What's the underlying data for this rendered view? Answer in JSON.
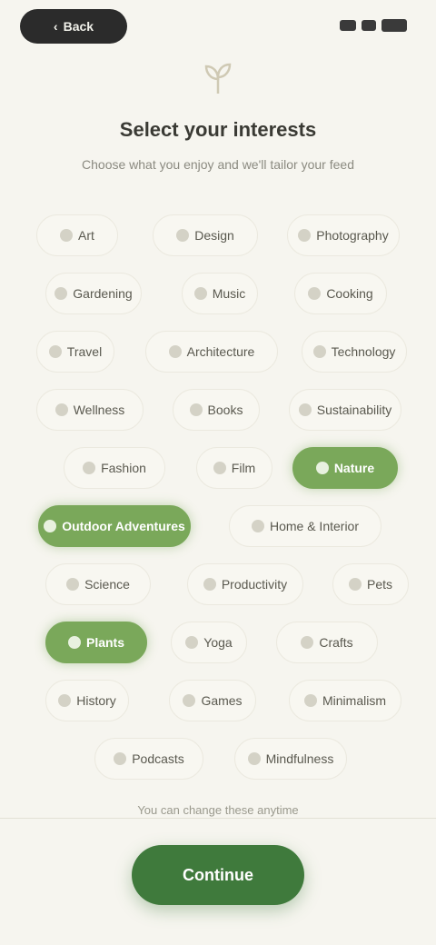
{
  "topbar": {
    "back_label": "Back"
  },
  "header": {
    "icon": "sprout-icon",
    "title": "Select your interests",
    "subtitle": "Choose what you enjoy and we'll tailor your feed"
  },
  "chips": [
    [
      {
        "label": "Art",
        "selected": false
      },
      {
        "label": "Design",
        "selected": false
      },
      {
        "label": "Photography",
        "selected": false
      }
    ],
    [
      {
        "label": "Gardening",
        "selected": false
      },
      {
        "label": "Music",
        "selected": false
      },
      {
        "label": "Cooking",
        "selected": false
      }
    ],
    [
      {
        "label": "Travel",
        "selected": false
      },
      {
        "label": "Architecture",
        "selected": false
      },
      {
        "label": "Technology",
        "selected": false
      }
    ],
    [
      {
        "label": "Wellness",
        "selected": false
      },
      {
        "label": "Books",
        "selected": false
      },
      {
        "label": "Sustainability",
        "selected": false
      }
    ],
    [
      {
        "label": "Fashion",
        "selected": false
      },
      {
        "label": "Film",
        "selected": false
      },
      {
        "label": "Nature",
        "selected": true
      }
    ],
    [
      {
        "label": "Outdoor Adventures",
        "selected": true
      },
      {
        "label": "Home & Interior",
        "selected": false
      }
    ],
    [
      {
        "label": "Science",
        "selected": false
      },
      {
        "label": "Productivity",
        "selected": false
      },
      {
        "label": "Pets",
        "selected": false
      }
    ],
    [
      {
        "label": "Plants",
        "selected": true
      },
      {
        "label": "Yoga",
        "selected": false
      },
      {
        "label": "Crafts",
        "selected": false
      }
    ],
    [
      {
        "label": "History",
        "selected": false
      },
      {
        "label": "Games",
        "selected": false
      },
      {
        "label": "Minimalism",
        "selected": false
      }
    ],
    [
      {
        "label": "Podcasts",
        "selected": false
      },
      {
        "label": "Mindfulness",
        "selected": false
      }
    ]
  ],
  "footer": {
    "note": "You can change these anytime",
    "continue_label": "Continue"
  },
  "colors": {
    "background": "#f6f5ef",
    "accent": "#7aa85a",
    "primary_button": "#3f7a3c"
  }
}
